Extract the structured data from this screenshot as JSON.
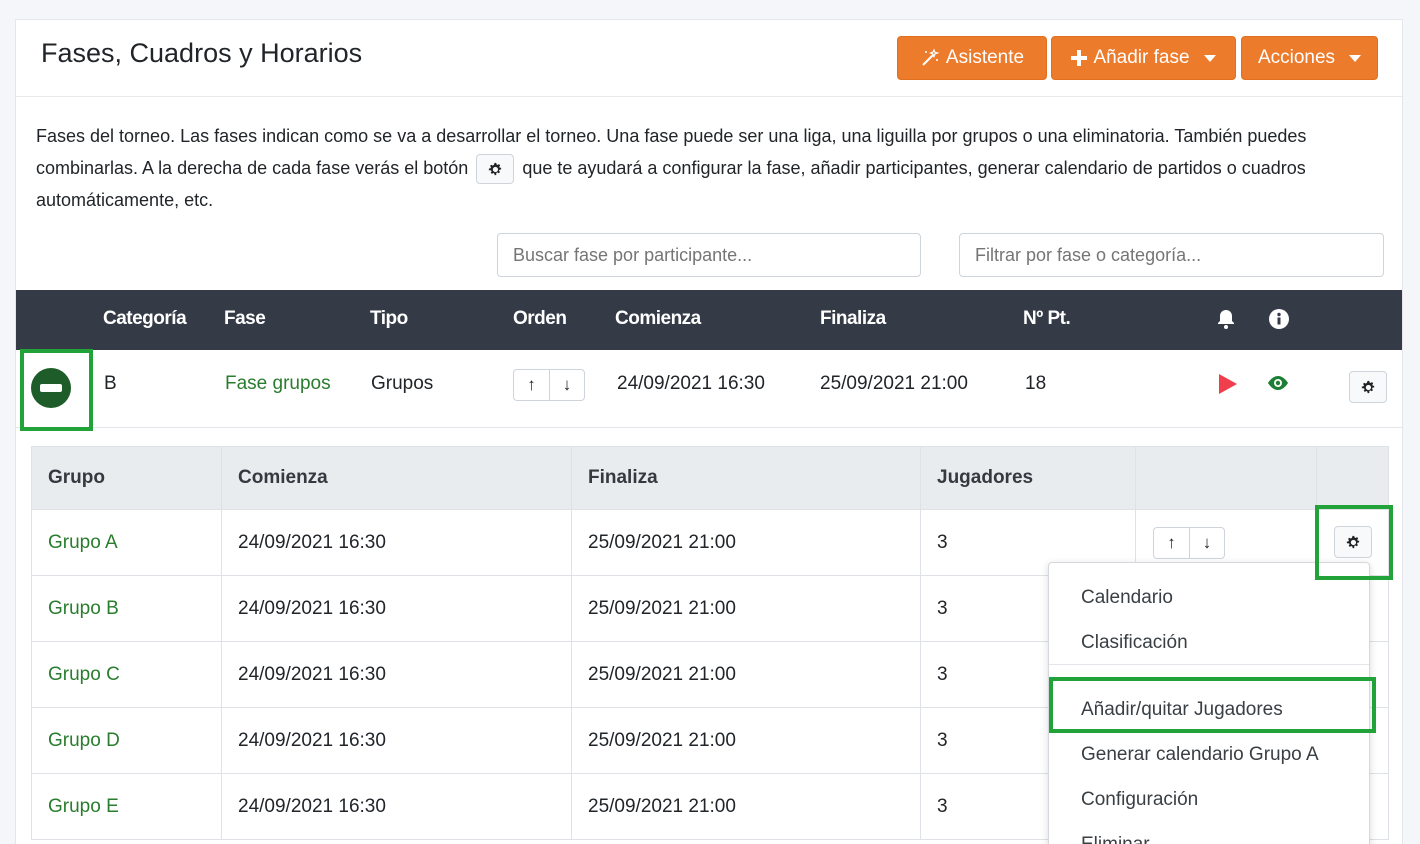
{
  "header": {
    "title": "Fases, Cuadros y Horarios",
    "btn_asistente": "Asistente",
    "btn_anadir": "Añadir fase",
    "btn_acciones": "Acciones"
  },
  "description": {
    "part1": "Fases del torneo. Las fases indican como se va a desarrollar el torneo. Una fase puede ser una liga, una liguilla por grupos o una eliminatoria. También puedes combinarlas. A la derecha de cada fase verás el botón",
    "part2": "que te ayudará a configurar la fase, añadir participantes, generar calendario de partidos o cuadros automáticamente, etc."
  },
  "search": {
    "participant_placeholder": "Buscar fase por participante...",
    "filter_placeholder": "Filtrar por fase o categoría..."
  },
  "main_table": {
    "headers": {
      "categoria": "Categoría",
      "fase": "Fase",
      "tipo": "Tipo",
      "orden": "Orden",
      "comienza": "Comienza",
      "finaliza": "Finaliza",
      "npt": "Nº Pt."
    },
    "row": {
      "categoria": "B",
      "fase": "Fase grupos",
      "tipo": "Grupos",
      "comienza": "24/09/2021 16:30",
      "finaliza": "25/09/2021 21:00",
      "npt": "18"
    }
  },
  "sub_table": {
    "headers": {
      "grupo": "Grupo",
      "comienza": "Comienza",
      "finaliza": "Finaliza",
      "jugadores": "Jugadores"
    },
    "rows": [
      {
        "grupo": "Grupo A",
        "comienza": "24/09/2021 16:30",
        "finaliza": "25/09/2021 21:00",
        "jugadores": "3"
      },
      {
        "grupo": "Grupo B",
        "comienza": "24/09/2021 16:30",
        "finaliza": "25/09/2021 21:00",
        "jugadores": "3"
      },
      {
        "grupo": "Grupo C",
        "comienza": "24/09/2021 16:30",
        "finaliza": "25/09/2021 21:00",
        "jugadores": "3"
      },
      {
        "grupo": "Grupo D",
        "comienza": "24/09/2021 16:30",
        "finaliza": "25/09/2021 21:00",
        "jugadores": "3"
      },
      {
        "grupo": "Grupo E",
        "comienza": "24/09/2021 16:30",
        "finaliza": "25/09/2021 21:00",
        "jugadores": "3"
      }
    ]
  },
  "dropdown": {
    "calendario": "Calendario",
    "clasificacion": "Clasificación",
    "anadir_quitar": "Añadir/quitar Jugadores",
    "generar": "Generar calendario Grupo A",
    "configuracion": "Configuración",
    "eliminar": "Eliminar"
  },
  "colors": {
    "accent_orange": "#ec7b2b",
    "header_dark": "#343a46",
    "link_green": "#2a7d2e",
    "highlight_green": "#22a33a",
    "play_red": "#f03e4d"
  },
  "icons": [
    "magic-wand-icon",
    "plus-icon",
    "caret-down-icon",
    "gear-icon",
    "bell-icon",
    "info-icon",
    "minus-circle-icon",
    "arrow-up-icon",
    "arrow-down-icon",
    "play-icon",
    "eye-icon"
  ]
}
